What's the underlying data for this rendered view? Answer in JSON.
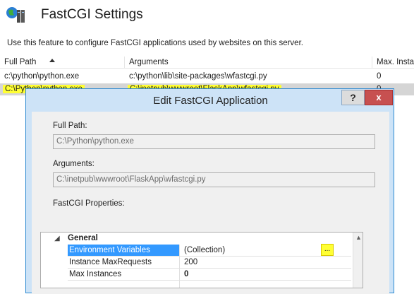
{
  "header": {
    "title": "FastCGI Settings",
    "description": "Use this feature to configure FastCGI applications used by websites on this server."
  },
  "list": {
    "columns": [
      "Full Path",
      "Arguments",
      "Max. Insta"
    ],
    "rows": [
      {
        "full_path": "c:\\python\\python.exe",
        "arguments": "c:\\python\\lib\\site-packages\\wfastcgi.py",
        "max": "0"
      },
      {
        "full_path": "C:\\Python\\python.exe",
        "arguments": "C:\\inetpub\\wwwroot\\FlaskApp\\wfastcgi.py",
        "max": "0"
      }
    ]
  },
  "dialog": {
    "title": "Edit FastCGI Application",
    "help_label": "?",
    "close_label": "x",
    "full_path_label": "Full Path:",
    "full_path_value": "C:\\Python\\python.exe",
    "arguments_label": "Arguments:",
    "arguments_value": "C:\\inetpub\\wwwroot\\FlaskApp\\wfastcgi.py",
    "properties_label": "FastCGI Properties:",
    "group_label": "General",
    "properties": [
      {
        "name": "Environment Variables",
        "value": "(Collection)"
      },
      {
        "name": "Instance MaxRequests",
        "value": "200"
      },
      {
        "name": "Max Instances",
        "value": "0"
      }
    ],
    "ellipsis_label": "..."
  },
  "colors": {
    "highlight": "#ffff33",
    "selection": "#3399ff",
    "dialog_frame": "#cde3f7"
  }
}
